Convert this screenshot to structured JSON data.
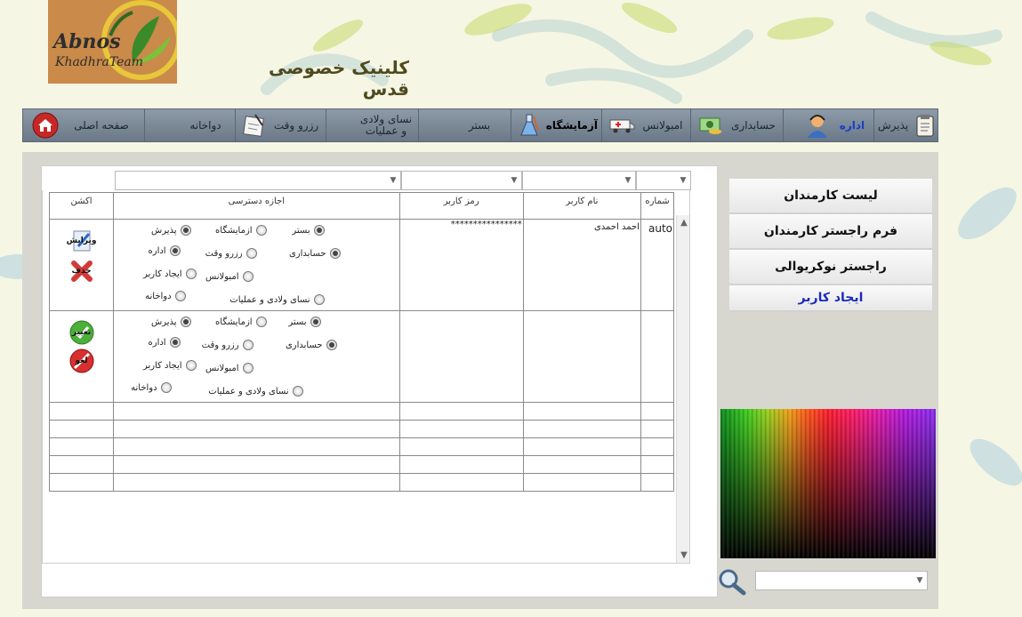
{
  "header": {
    "logo_line1": "Abnos",
    "logo_line2": "KhadhraTeam",
    "clinic_title": "کلینیک خصوصی قدس"
  },
  "nav": {
    "items": [
      {
        "label": "پذیرش",
        "icon": "clipboard-icon"
      },
      {
        "label": "اداره",
        "icon": "user-icon",
        "style": "blue"
      },
      {
        "label": "حسابداری",
        "icon": "money-icon"
      },
      {
        "label": "امبولانس",
        "icon": "ambulance-icon"
      },
      {
        "label": "آزمایشگاه",
        "icon": "flask-icon",
        "style": "active"
      },
      {
        "label": "بستر",
        "icon": ""
      },
      {
        "label": "نسای ولادی و عملیات",
        "icon": ""
      },
      {
        "label": "رزرو وقت",
        "icon": "calendar-icon"
      },
      {
        "label": "دواخانه",
        "icon": ""
      },
      {
        "label": "صفحه اصلی",
        "icon": "home-icon"
      }
    ]
  },
  "grid": {
    "headers": [
      "شماره",
      "نام کاربر",
      "رمز کاربر",
      "اجازه دسترسی",
      "اکشن"
    ],
    "rows": [
      {
        "id": "auto",
        "username": "احمد احمدی",
        "password": "****************"
      },
      {
        "id": "",
        "username": "",
        "password": ""
      }
    ],
    "permissions": {
      "bastar": "بستر",
      "azmayeshgah": "ازمایشگاه",
      "paziresh": "پذیرش",
      "hesabdari": "حسابداری",
      "rezerv": "رزرو وقت",
      "edare": "اداره",
      "ambulance": "امبولانس",
      "ijad_karbar": "ایجاد کاربر",
      "nesai": "نسای ولادی و عملیات",
      "dawakhana": "دواخانه"
    },
    "actions": {
      "edit": "ویرایش",
      "delete": "حذف",
      "save": "تغییر",
      "cancel": "لغو"
    }
  },
  "side_menu": {
    "items": [
      "لیست کارمندان",
      "فرم راجستر کارمندان",
      "راجستر نوکریوالی",
      "ایجاد کاربر"
    ]
  },
  "colors": {
    "nav_bg": "#7d8a98",
    "active_menu": "#1a2bb8"
  }
}
